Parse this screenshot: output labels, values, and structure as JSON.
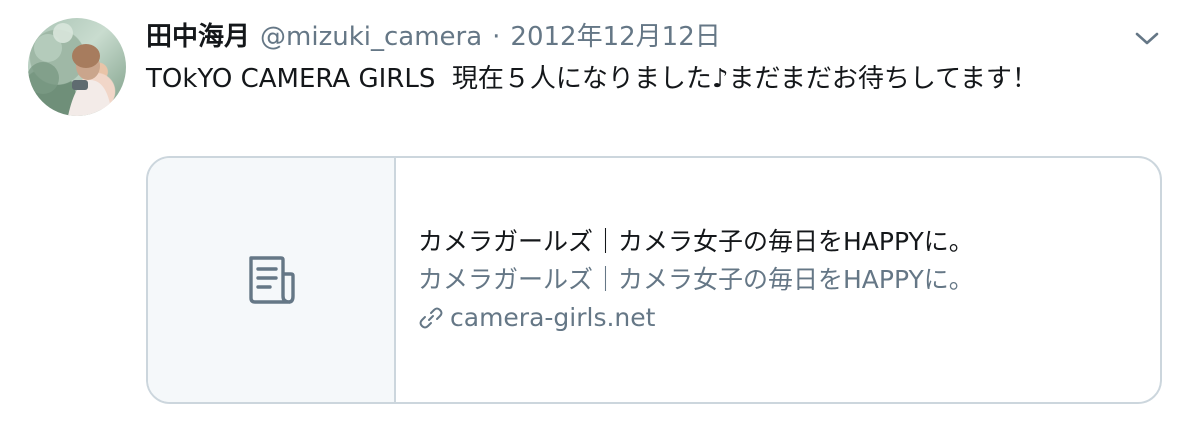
{
  "tweet": {
    "display_name": "田中海月",
    "handle": "@mizuki_camera",
    "separator": "·",
    "date": "2012年12月12日",
    "text": "TOkYO CAMERA GIRLS  現在５人になりました♪まだまだお待ちしてます！"
  },
  "card": {
    "title": "カメラガールズ｜カメラ女子の毎日をHAPPYに。",
    "description": "カメラガールズ｜カメラ女子の毎日をHAPPYに。",
    "domain": "camera-girls.net"
  },
  "icons": {
    "menu": "chevron-down-icon",
    "card_placeholder": "document-icon",
    "link": "link-icon"
  },
  "colors": {
    "text_primary": "#14171a",
    "text_secondary": "#657786",
    "border": "#ccd6dd",
    "card_thumb_bg": "#f5f8fa"
  }
}
